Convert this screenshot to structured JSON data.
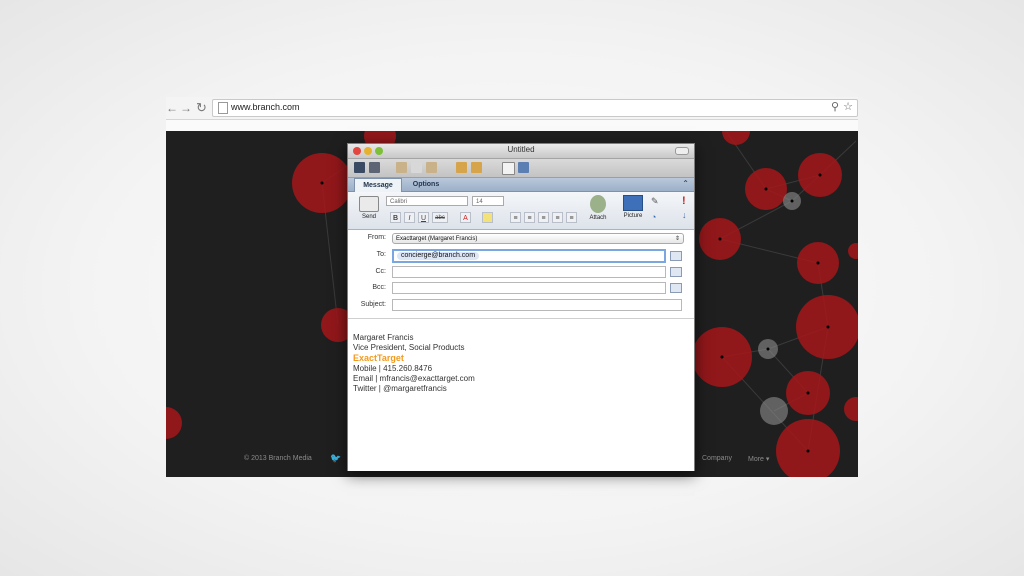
{
  "browser": {
    "back_icon": "back-arrow-icon",
    "forward_icon": "forward-arrow-icon",
    "reload_icon": "reload-icon",
    "url": "www.branch.com"
  },
  "page": {
    "footer_copyright": "© 2013 Branch Media",
    "footer_links": [
      "Company",
      "More ▾"
    ]
  },
  "mail": {
    "window_title": "Untitled",
    "tabs": [
      {
        "label": "Message"
      },
      {
        "label": "Options"
      }
    ],
    "ribbon": {
      "send_label": "Send",
      "font_name": "Calibri",
      "font_size": "14",
      "format_buttons": [
        "B",
        "I",
        "U",
        "abc"
      ],
      "attach_label": "Attach",
      "picture_label": "Picture"
    },
    "fields": {
      "from_label": "From:",
      "from_value": "Exacttarget (Margaret Francis)",
      "to_label": "To:",
      "to_value": "concierge@branch.com",
      "cc_label": "Cc:",
      "bcc_label": "Bcc:",
      "subject_label": "Subject:"
    },
    "signature": {
      "name": "Margaret Francis",
      "title": "Vice President, Social Products",
      "company": "ExactTarget",
      "mobile": "Mobile  | 415.260.8476",
      "email": "Email | mfrancis@exacttarget.com",
      "twitter": "Twitter | @margaretfrancis"
    },
    "colors": {
      "company_accent": "#f39a1e",
      "priority_red": "#d01f1f"
    }
  }
}
